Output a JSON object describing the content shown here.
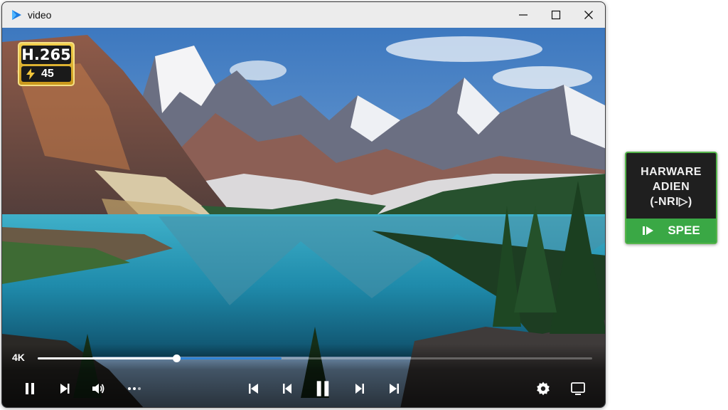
{
  "window": {
    "title": "video"
  },
  "video": {
    "codec_badge": {
      "codec": "H.265",
      "value": "45"
    },
    "quality": "4K",
    "progress": {
      "played": 0.25,
      "buffered": 0.44
    }
  },
  "controls": {
    "left": [
      "pause-icon",
      "next-icon",
      "volume-icon",
      "more-icon"
    ],
    "center": [
      "skip-start-icon",
      "previous-icon",
      "pause-icon",
      "next-icon",
      "skip-end-icon"
    ],
    "right": [
      "settings-icon",
      "cast-icon"
    ]
  },
  "hw_badge": {
    "line1": "HARWARE",
    "line2": "ADIEN",
    "line3": "(-NRI▷)",
    "footer": "SPEE"
  },
  "colors": {
    "accent": "#2f84d6",
    "badge_gold": "#e2b52e",
    "hw_green": "#3aa845"
  }
}
